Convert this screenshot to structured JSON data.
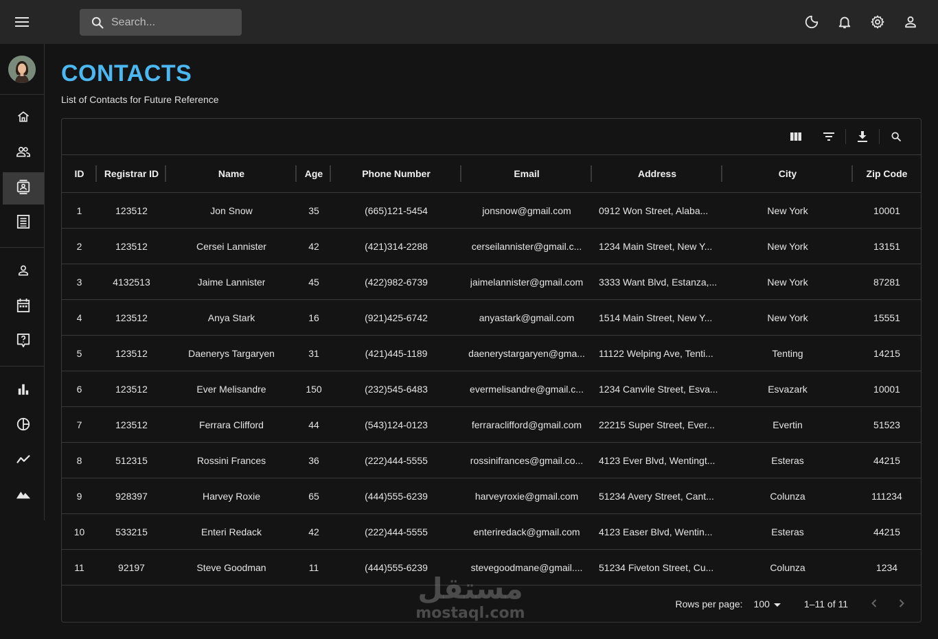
{
  "search": {
    "placeholder": "Search..."
  },
  "icons": {
    "menu": "menu-icon",
    "search": "search-icon",
    "dark_mode": "moon-icon",
    "notifications": "bell-icon",
    "settings": "gear-icon",
    "profile": "person-icon"
  },
  "colors": {
    "accent": "#4cb8f2",
    "background": "#141414",
    "topbar": "#262626"
  },
  "sidebar": {
    "items": [
      {
        "id": "home",
        "icon": "home-icon"
      },
      {
        "id": "team",
        "icon": "people-icon"
      },
      {
        "id": "contacts",
        "icon": "contacts-icon",
        "active": true
      },
      {
        "id": "invoices",
        "icon": "receipt-icon"
      },
      {
        "id": "profile-form",
        "icon": "person-icon"
      },
      {
        "id": "calendar",
        "icon": "calendar-icon"
      },
      {
        "id": "faq",
        "icon": "help-icon"
      },
      {
        "id": "bar-chart",
        "icon": "bar-chart-icon"
      },
      {
        "id": "pie-chart",
        "icon": "pie-chart-icon"
      },
      {
        "id": "line-chart",
        "icon": "line-chart-icon"
      },
      {
        "id": "geography",
        "icon": "mountain-icon"
      }
    ]
  },
  "header": {
    "title": "CONTACTS",
    "subtitle": "List of Contacts for Future Reference"
  },
  "table": {
    "columns": [
      "ID",
      "Registrar ID",
      "Name",
      "Age",
      "Phone Number",
      "Email",
      "Address",
      "City",
      "Zip Code"
    ],
    "rows": [
      [
        "1",
        "123512",
        "Jon Snow",
        "35",
        "(665)121-5454",
        "jonsnow@gmail.com",
        "0912 Won Street, Alaba...",
        "New York",
        "10001"
      ],
      [
        "2",
        "123512",
        "Cersei Lannister",
        "42",
        "(421)314-2288",
        "cerseilannister@gmail.c...",
        "1234 Main Street, New Y...",
        "New York",
        "13151"
      ],
      [
        "3",
        "4132513",
        "Jaime Lannister",
        "45",
        "(422)982-6739",
        "jaimelannister@gmail.com",
        "3333 Want Blvd, Estanza,...",
        "New York",
        "87281"
      ],
      [
        "4",
        "123512",
        "Anya Stark",
        "16",
        "(921)425-6742",
        "anyastark@gmail.com",
        "1514 Main Street, New Y...",
        "New York",
        "15551"
      ],
      [
        "5",
        "123512",
        "Daenerys Targaryen",
        "31",
        "(421)445-1189",
        "daenerystargaryen@gma...",
        "11122 Welping Ave, Tenti...",
        "Tenting",
        "14215"
      ],
      [
        "6",
        "123512",
        "Ever Melisandre",
        "150",
        "(232)545-6483",
        "evermelisandre@gmail.c...",
        "1234 Canvile Street, Esva...",
        "Esvazark",
        "10001"
      ],
      [
        "7",
        "123512",
        "Ferrara Clifford",
        "44",
        "(543)124-0123",
        "ferraraclifford@gmail.com",
        "22215 Super Street, Ever...",
        "Evertin",
        "51523"
      ],
      [
        "8",
        "512315",
        "Rossini Frances",
        "36",
        "(222)444-5555",
        "rossinifrances@gmail.co...",
        "4123 Ever Blvd, Wentingt...",
        "Esteras",
        "44215"
      ],
      [
        "9",
        "928397",
        "Harvey Roxie",
        "65",
        "(444)555-6239",
        "harveyroxie@gmail.com",
        "51234 Avery Street, Cant...",
        "Colunza",
        "111234"
      ],
      [
        "10",
        "533215",
        "Enteri Redack",
        "42",
        "(222)444-5555",
        "enteriredack@gmail.com",
        "4123 Easer Blvd, Wentin...",
        "Esteras",
        "44215"
      ],
      [
        "11",
        "92197",
        "Steve Goodman",
        "11",
        "(444)555-6239",
        "stevegoodmane@gmail....",
        "51234 Fiveton Street, Cu...",
        "Colunza",
        "1234"
      ]
    ]
  },
  "toolbar": {
    "icons": [
      "columns-icon",
      "filter-icon",
      "download-icon",
      "search-icon"
    ]
  },
  "footer": {
    "rows_per_page_label": "Rows per page:",
    "rows_per_page_value": "100",
    "page_info": "1–11 of 11"
  },
  "watermark": {
    "arabic": "مستقل",
    "latin": "mostaql.com"
  }
}
